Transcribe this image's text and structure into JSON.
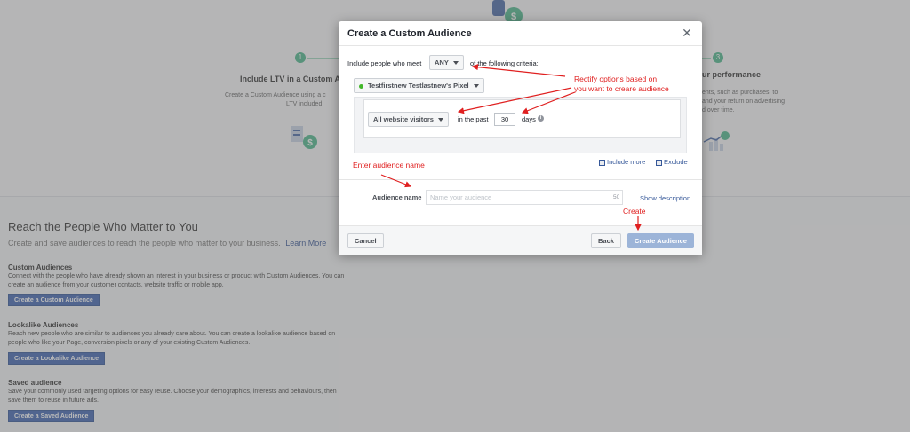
{
  "background": {
    "steps": [
      {
        "num": "1",
        "title": "Include LTV in a Custom A",
        "desc": [
          "Create a Custom Audience using a c",
          "LTV included."
        ]
      },
      {
        "num": "3",
        "title": "ur performance",
        "desc": [
          "ents, such as purchases, to",
          "and your return on advertising",
          "d over time."
        ]
      }
    ],
    "reach_title": "Reach the People Who Matter to You",
    "reach_sub": "Create and save audiences to reach the people who matter to your business.",
    "learn_more": "Learn More",
    "sections": [
      {
        "title": "Custom Audiences",
        "desc": "Connect with the people who have already shown an interest in your business or product with Custom Audiences. You can create an audience from your customer contacts, website traffic or mobile app.",
        "button": "Create a Custom Audience"
      },
      {
        "title": "Lookalike Audiences",
        "desc": "Reach new people who are similar to audiences you already care about. You can create a lookalike audience based on people who like your Page, conversion pixels or any of your existing Custom Audiences.",
        "button": "Create a Lookalike Audience"
      },
      {
        "title": "Saved audience",
        "desc": "Save your commonly used targeting options for easy reuse. Choose your demographics, interests and behaviours, then save them to reuse in future ads.",
        "button": "Create a Saved Audience"
      }
    ]
  },
  "modal": {
    "title": "Create a Custom Audience",
    "close_icon": "close-icon",
    "criteria_prefix": "Include people who meet",
    "criteria_value": "ANY",
    "criteria_suffix": "of the following criteria:",
    "pixel_name": "Testfirstnew Testlastnew's Pixel",
    "visitors_option": "All website visitors",
    "in_the_past": "in the past",
    "days_value": "30",
    "days_label": "days",
    "include_more": "Include more",
    "exclude": "Exclude",
    "audience_name_label": "Audience name",
    "audience_name_placeholder": "Name your audience",
    "audience_name_count": "50",
    "show_description": "Show description",
    "cancel": "Cancel",
    "back": "Back",
    "create": "Create Audience"
  },
  "annotations": {
    "rectify": [
      "Rectify options based on",
      "you want to creare audience"
    ],
    "enter_name": "Enter audience name",
    "create": "Create"
  },
  "colors": {
    "accent": "#4267b2",
    "annotation": "#e02020",
    "pixel_dot": "#42b72a"
  }
}
